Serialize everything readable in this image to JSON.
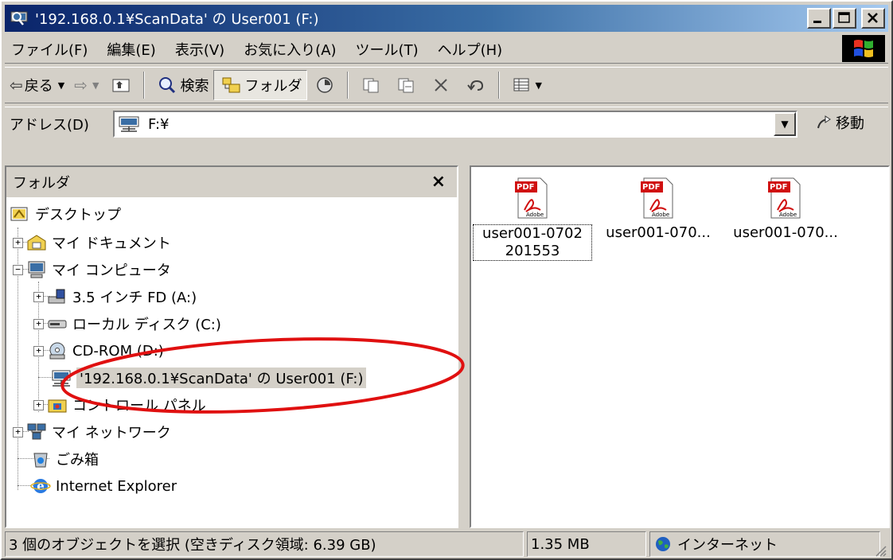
{
  "window": {
    "title": "'192.168.0.1¥ScanData' の User001 (F:)"
  },
  "menu": [
    "ファイル(F)",
    "編集(E)",
    "表示(V)",
    "お気に入り(A)",
    "ツール(T)",
    "ヘルプ(H)"
  ],
  "toolbar": {
    "back": "戻る",
    "search": "検索",
    "folders": "フォルダ"
  },
  "address": {
    "label": "アドレス(D)",
    "value": "F:¥",
    "go": "移動"
  },
  "folder_pane": {
    "title": "フォルダ",
    "close": "×",
    "tree": [
      {
        "label": "デスクトップ",
        "icon": "desktop-icon"
      },
      {
        "label": "マイ ドキュメント",
        "icon": "my-documents-icon"
      },
      {
        "label": "マイ コンピュータ",
        "icon": "my-computer-icon"
      },
      {
        "label": "3.5 インチ FD (A:)",
        "icon": "floppy-icon"
      },
      {
        "label": "ローカル ディスク (C:)",
        "icon": "hard-disk-icon"
      },
      {
        "label": "CD-ROM (D:)",
        "icon": "cdrom-icon"
      },
      {
        "label": "'192.168.0.1¥ScanData' の User001 (F:)",
        "icon": "network-drive-icon"
      },
      {
        "label": "コントロール パネル",
        "icon": "control-panel-icon"
      },
      {
        "label": "マイ ネットワーク",
        "icon": "my-network-icon"
      },
      {
        "label": "ごみ箱",
        "icon": "recycle-bin-icon"
      },
      {
        "label": "Internet Explorer",
        "icon": "internet-explorer-icon"
      }
    ]
  },
  "files": [
    {
      "name_line1": "user001-0702",
      "name_line2": "201553",
      "icon": "pdf-icon",
      "badge": "PDF",
      "brand": "Adobe"
    },
    {
      "name_line1": "user001-070...",
      "name_line2": "",
      "icon": "pdf-icon",
      "badge": "PDF",
      "brand": "Adobe"
    },
    {
      "name_line1": "user001-070...",
      "name_line2": "",
      "icon": "pdf-icon",
      "badge": "PDF",
      "brand": "Adobe"
    }
  ],
  "status": {
    "selection": "3 個のオブジェクトを選択 (空きディスク領域: 6.39 GB)",
    "size": "1.35 MB",
    "zone": "インターネット"
  },
  "colors": {
    "titlebar_start": "#0a246a",
    "titlebar_end": "#a6caf0",
    "annotation": "#e01010",
    "pdf_red": "#d01010"
  }
}
